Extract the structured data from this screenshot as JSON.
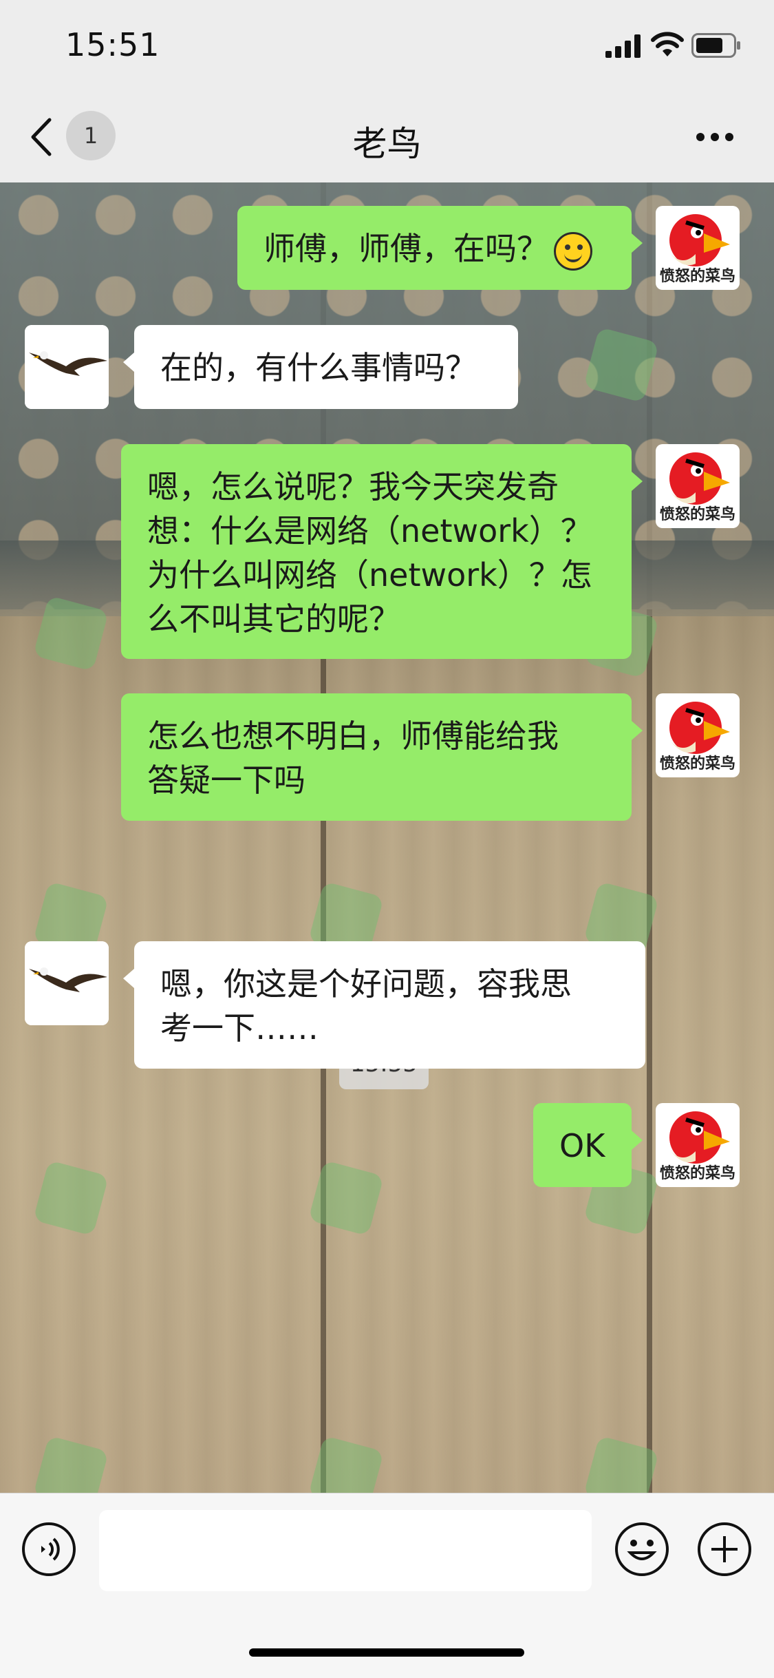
{
  "status_bar": {
    "time": "15:51"
  },
  "nav": {
    "back_badge": "1",
    "title": "老鸟"
  },
  "avatars": {
    "me_label": "愤怒的菜鸟"
  },
  "messages": [
    {
      "side": "right",
      "text": "师傅，师傅，在吗？"
    },
    {
      "side": "left",
      "text": "在的，有什么事情吗？"
    },
    {
      "side": "right",
      "text": "嗯，怎么说呢？我今天突发奇想：什么是网络（network）？为什么叫网络（network）？怎么不叫其它的呢？"
    },
    {
      "side": "right",
      "text": "怎么也想不明白，师傅能给我答疑一下吗"
    },
    {
      "side": "left",
      "text": "嗯，你这是个好问题，容我思考一下……"
    },
    {
      "side": "right",
      "text": "OK"
    }
  ],
  "timestamp": "15:55",
  "input": {
    "placeholder": ""
  },
  "colors": {
    "my_bubble": "#95ec69",
    "their_bubble": "#ffffff",
    "nav_bg": "#ededed"
  },
  "icons": [
    "signal-icon",
    "wifi-icon",
    "battery-icon",
    "back-icon",
    "more-icon",
    "voice-icon",
    "emoji-icon",
    "plus-icon"
  ]
}
